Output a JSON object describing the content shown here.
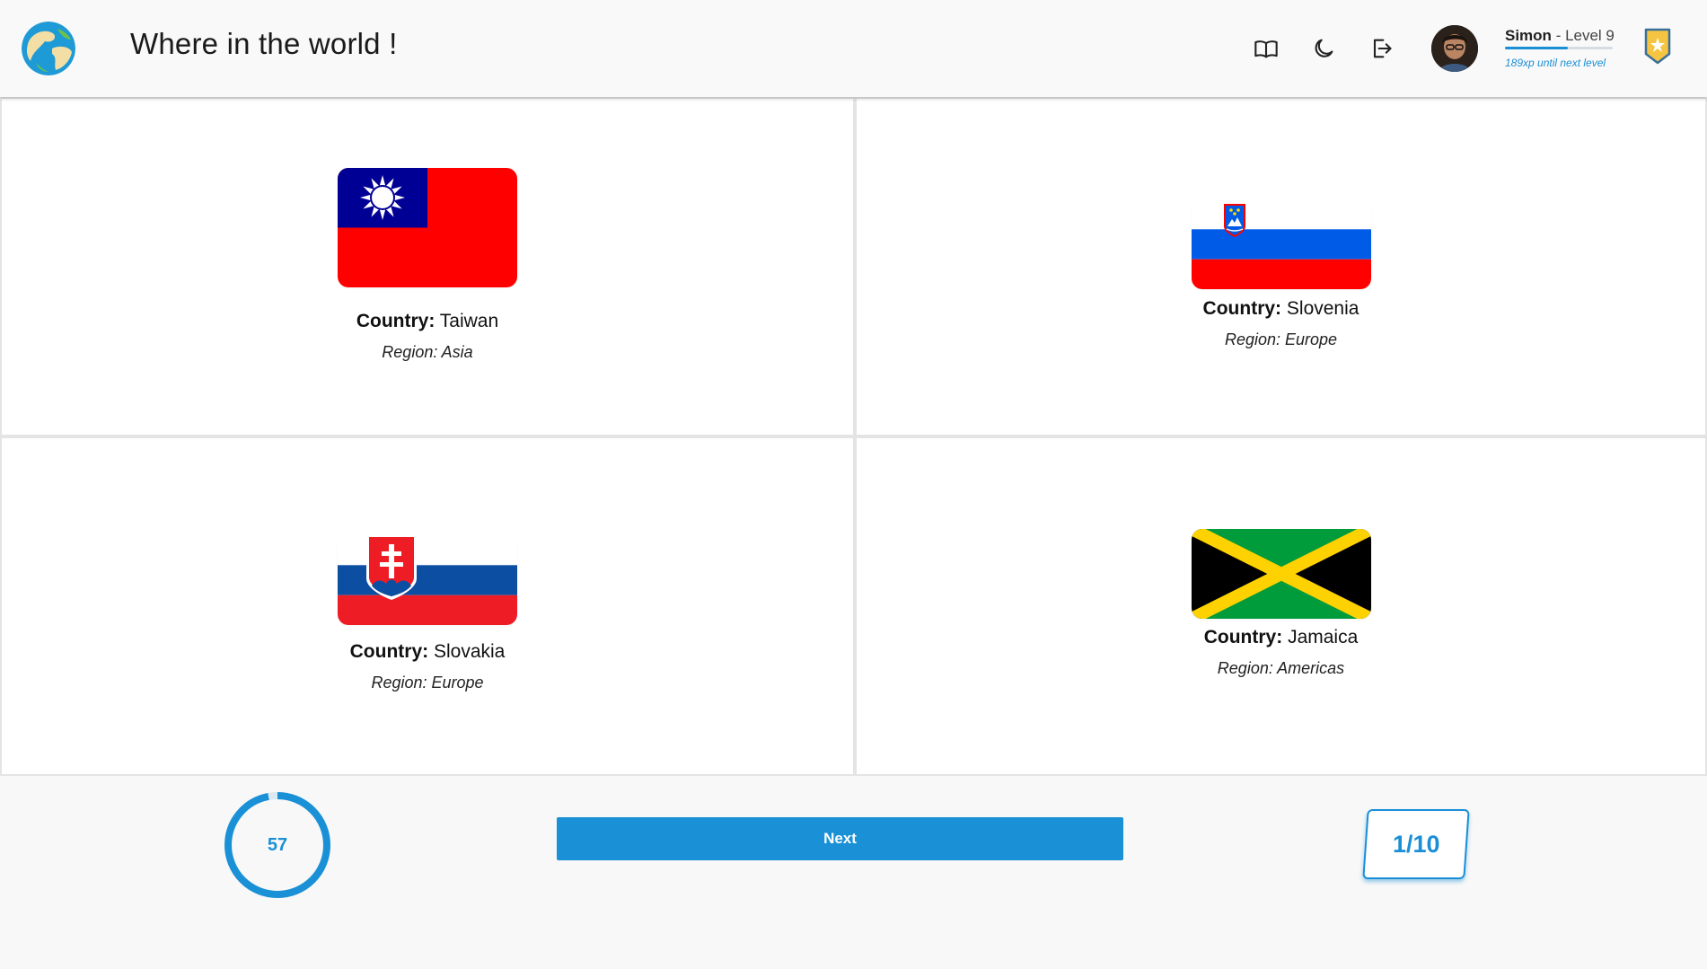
{
  "header": {
    "title": "Where in the world !",
    "icons": [
      "book-open-icon",
      "moon-icon",
      "logout-icon"
    ],
    "user": {
      "name": "Simon",
      "level_label": "- Level 9",
      "xp_text": "189xp until next level",
      "xp_progress_percent": 58
    },
    "badge_icon": "shield-star-icon"
  },
  "cards": [
    {
      "country_label": "Country:",
      "country": "Taiwan",
      "region": "Region: Asia",
      "flag": "taiwan-flag"
    },
    {
      "country_label": "Country:",
      "country": "Slovenia",
      "region": "Region: Europe",
      "flag": "slovenia-flag"
    },
    {
      "country_label": "Country:",
      "country": "Slovakia",
      "region": "Region: Europe",
      "flag": "slovakia-flag"
    },
    {
      "country_label": "Country:",
      "country": "Jamaica",
      "region": "Region: Americas",
      "flag": "jamaica-flag"
    }
  ],
  "footer": {
    "timer_value": "57",
    "timer_progress_percent": 97,
    "next_label": "Next",
    "counter": "1/10"
  },
  "colors": {
    "accent": "#1a90d6",
    "card_border": "#e4e4e4",
    "background": "#f8f8f8"
  }
}
